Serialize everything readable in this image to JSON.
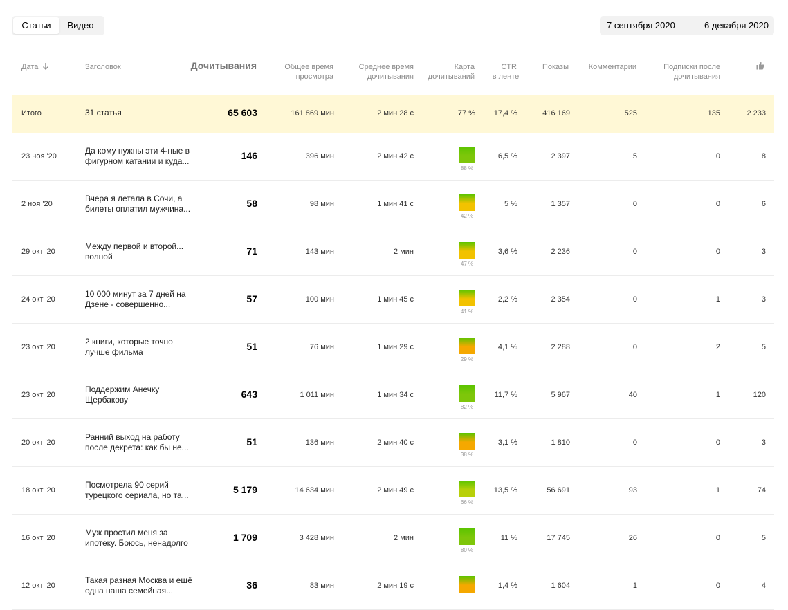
{
  "tabs": [
    {
      "label": "Статьи",
      "active": true
    },
    {
      "label": "Видео",
      "active": false
    }
  ],
  "date_range": {
    "from": "7 сентября 2020",
    "separator": "—",
    "to": "6 декабря 2020"
  },
  "columns": {
    "date": "Дата",
    "title": "Заголовок",
    "reads": "Дочитывания",
    "total_time": [
      "Общее время",
      "просмотра"
    ],
    "avg_time": [
      "Среднее время",
      "дочитывания"
    ],
    "read_map": [
      "Карта",
      "дочитываний"
    ],
    "ctr": [
      "CTR",
      "в ленте"
    ],
    "impressions": "Показы",
    "comments": "Комментарии",
    "subs": [
      "Подписки после",
      "дочитывания"
    ],
    "likes_icon": "thumbs-up-icon"
  },
  "total": {
    "label": "Итого",
    "title": "31 статья",
    "reads": "65 603",
    "total_time": "161 869 мин",
    "avg_time": "2 мин 28 с",
    "map": "77 %",
    "ctr": "17,4 %",
    "impressions": "416 169",
    "comments": "525",
    "subs": "135",
    "likes": "2 233"
  },
  "rows": [
    {
      "date": "23 ноя '20",
      "title": "Да кому нужны эти 4-ные в фигурном катании и куда...",
      "reads": "146",
      "total_time": "396 мин",
      "avg_time": "2 мин 42 с",
      "map": "88 %",
      "map_value": 88,
      "ctr": "6,5 %",
      "impressions": "2 397",
      "comments": "5",
      "subs": "0",
      "likes": "8"
    },
    {
      "date": "2 ноя '20",
      "title": "Вчера я летала в Сочи, а билеты оплатил мужчина...",
      "reads": "58",
      "total_time": "98 мин",
      "avg_time": "1 мин 41 с",
      "map": "42 %",
      "map_value": 42,
      "ctr": "5 %",
      "impressions": "1 357",
      "comments": "0",
      "subs": "0",
      "likes": "6"
    },
    {
      "date": "29 окт '20",
      "title": "Между первой и второй... волной",
      "reads": "71",
      "total_time": "143 мин",
      "avg_time": "2 мин",
      "map": "47 %",
      "map_value": 47,
      "ctr": "3,6 %",
      "impressions": "2 236",
      "comments": "0",
      "subs": "0",
      "likes": "3"
    },
    {
      "date": "24 окт '20",
      "title": "10 000 минут за 7 дней на Дзене - совершенно...",
      "reads": "57",
      "total_time": "100 мин",
      "avg_time": "1 мин 45 с",
      "map": "41 %",
      "map_value": 41,
      "ctr": "2,2 %",
      "impressions": "2 354",
      "comments": "0",
      "subs": "1",
      "likes": "3"
    },
    {
      "date": "23 окт '20",
      "title": "2 книги, которые точно лучше фильма",
      "reads": "51",
      "total_time": "76 мин",
      "avg_time": "1 мин 29 с",
      "map": "29 %",
      "map_value": 29,
      "ctr": "4,1 %",
      "impressions": "2 288",
      "comments": "0",
      "subs": "2",
      "likes": "5"
    },
    {
      "date": "23 окт '20",
      "title": "Поддержим Анечку Щербакову",
      "reads": "643",
      "total_time": "1 011 мин",
      "avg_time": "1 мин 34 с",
      "map": "82 %",
      "map_value": 82,
      "ctr": "11,7 %",
      "impressions": "5 967",
      "comments": "40",
      "subs": "1",
      "likes": "120"
    },
    {
      "date": "20 окт '20",
      "title": "Ранний выход на работу после декрета: как бы не...",
      "reads": "51",
      "total_time": "136 мин",
      "avg_time": "2 мин 40 с",
      "map": "38 %",
      "map_value": 38,
      "ctr": "3,1 %",
      "impressions": "1 810",
      "comments": "0",
      "subs": "0",
      "likes": "3"
    },
    {
      "date": "18 окт '20",
      "title": "Посмотрела 90 серий турецкого сериала, но та...",
      "reads": "5 179",
      "total_time": "14 634 мин",
      "avg_time": "2 мин 49 с",
      "map": "66 %",
      "map_value": 66,
      "ctr": "13,5 %",
      "impressions": "56 691",
      "comments": "93",
      "subs": "1",
      "likes": "74"
    },
    {
      "date": "16 окт '20",
      "title": "Муж простил меня за ипотеку. Боюсь, ненадолго",
      "reads": "1 709",
      "total_time": "3 428 мин",
      "avg_time": "2 мин",
      "map": "80 %",
      "map_value": 80,
      "ctr": "11 %",
      "impressions": "17 745",
      "comments": "26",
      "subs": "0",
      "likes": "5"
    },
    {
      "date": "12 окт '20",
      "title": "Такая разная Москва и ещё одна наша семейная...",
      "reads": "36",
      "total_time": "83 мин",
      "avg_time": "2 мин 19 с",
      "map": "",
      "map_value": 30,
      "ctr": "1,4 %",
      "impressions": "1 604",
      "comments": "1",
      "subs": "0",
      "likes": "4"
    }
  ]
}
